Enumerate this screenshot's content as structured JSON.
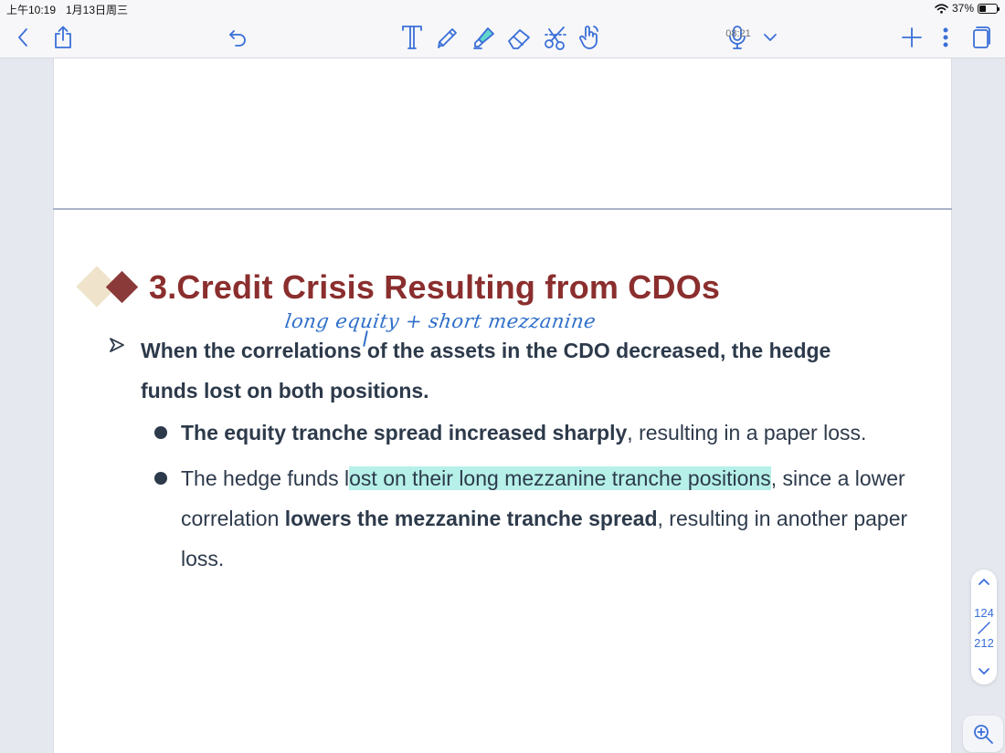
{
  "status_bar": {
    "time": "上午10:19",
    "date": "1月13日周三",
    "battery": "37%",
    "battery_level": 0.37
  },
  "toolbar": {
    "recording_time": "08:21",
    "left_tools": [
      "back-chevron-icon",
      "share-icon",
      "undo-icon"
    ],
    "center_tools": [
      "text-tool-icon",
      "pen-icon",
      "highlighter-icon",
      "eraser-icon",
      "lasso-scissors-icon",
      "finger-pointer-icon"
    ],
    "right_tools": [
      "microphone-icon",
      "chevron-down-icon",
      "plus-icon",
      "more-vertical-icon",
      "page-view-icon"
    ],
    "accent_color": "#3a6fd8",
    "highlighter_color": "#62d6cc"
  },
  "slide": {
    "title": "3.Credit Crisis Resulting from CDOs",
    "title_color": "#8b2e2e",
    "handwritten_note": "long equity + short mezzanine",
    "main_point": "When the correlations of the assets in the CDO decreased, the hedge funds lost on both positions.",
    "sub_points": [
      {
        "bold_lead": "The equity tranche spread increased sharply",
        "rest": ", resulting in a paper loss."
      },
      {
        "prefix": "The hedge funds l",
        "highlighted": "ost on their long mezzanine tranche positions",
        "middle": ", since a lower correlation ",
        "bold": "lowers the mezzanine tranche spread",
        "suffix": ", resulting in another paper loss."
      }
    ],
    "highlight_color": "#b6f0e8"
  },
  "pager": {
    "current": "124",
    "total": "212"
  }
}
